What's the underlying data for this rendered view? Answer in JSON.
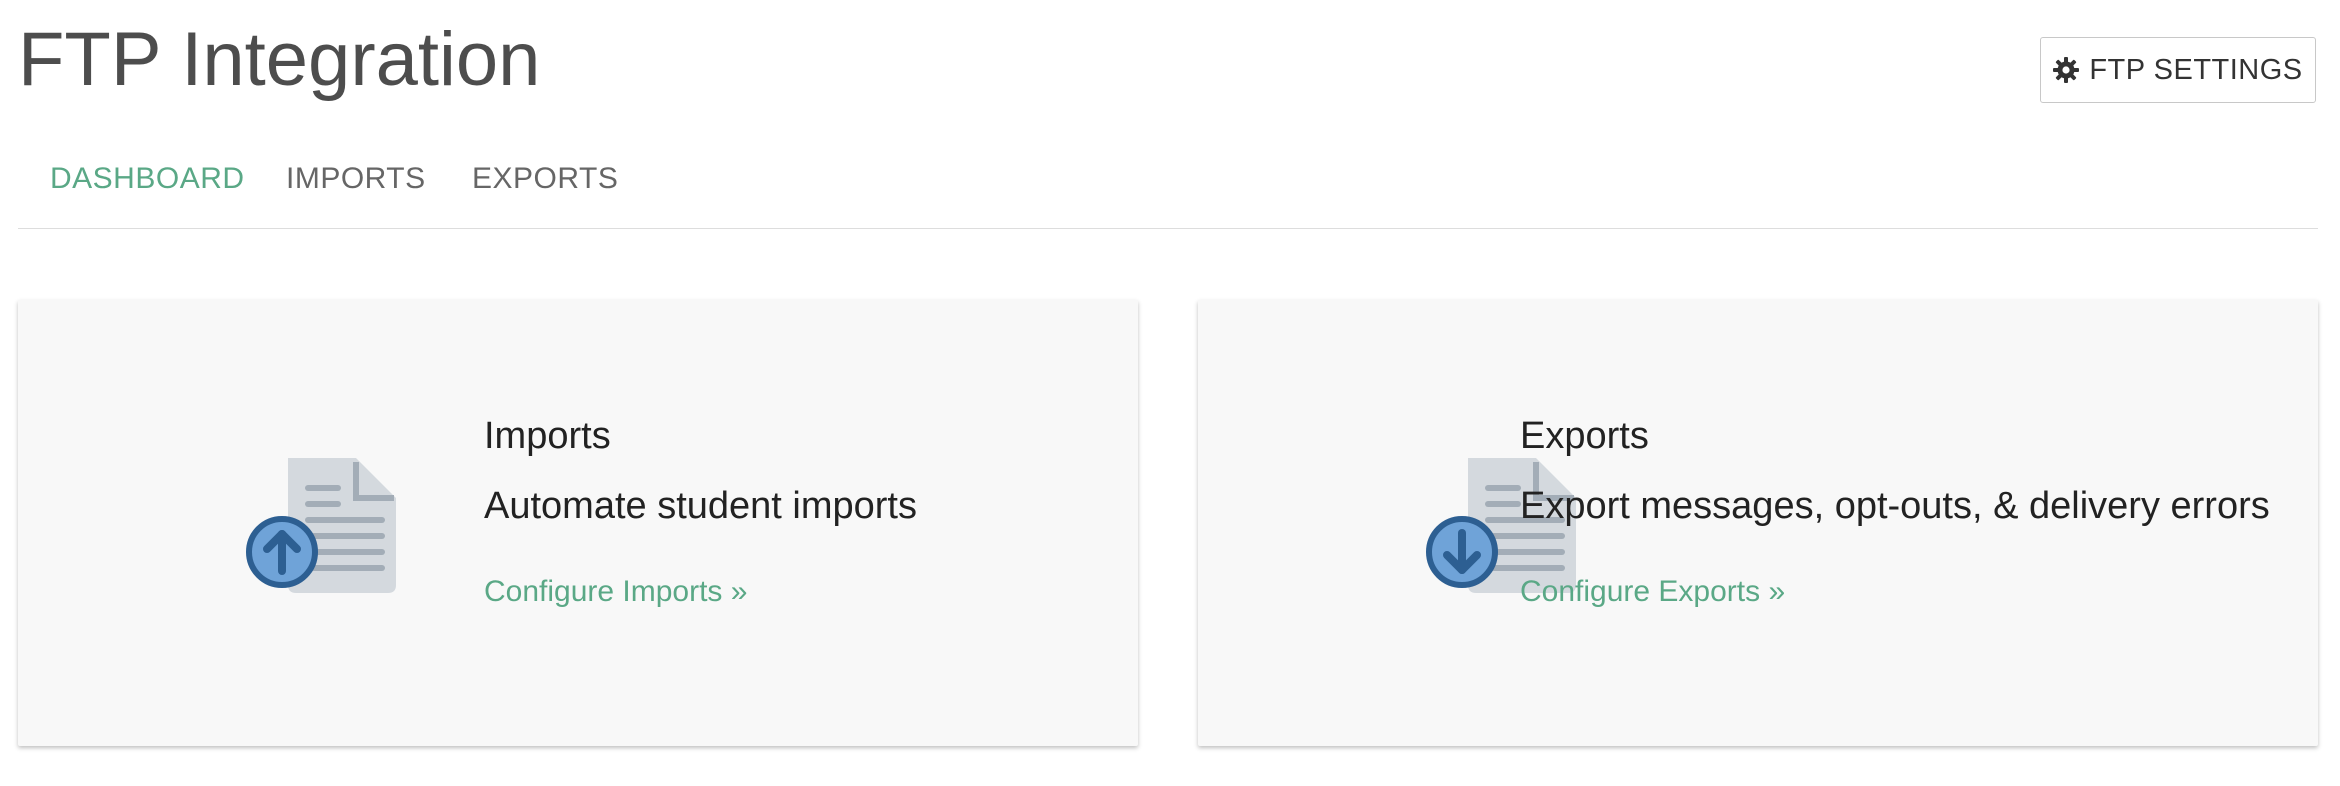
{
  "header": {
    "title": "FTP Integration",
    "settings_button": {
      "icon": "gear-icon",
      "label": "FTP SETTINGS"
    }
  },
  "tabs": [
    {
      "label": "DASHBOARD",
      "active": true
    },
    {
      "label": "IMPORTS",
      "active": false
    },
    {
      "label": "EXPORTS",
      "active": false
    }
  ],
  "cards": [
    {
      "icon": "document-upload-icon",
      "title": "Imports",
      "description": "Automate student imports",
      "link": "Configure Imports »"
    },
    {
      "icon": "document-download-icon",
      "title": "Exports",
      "description": "Export messages, opt-outs, & delivery errors",
      "link": "Configure Exports »"
    }
  ],
  "colors": {
    "accent": "#5aa886",
    "title": "#4d4d4d",
    "tab_inactive": "#666666",
    "card_background": "#f8f8f8",
    "doc_icon_fill": "#d4d9de",
    "doc_icon_lines": "#a3adb7",
    "badge_fill": "#6fa3d8",
    "badge_border": "#2d5f92"
  }
}
